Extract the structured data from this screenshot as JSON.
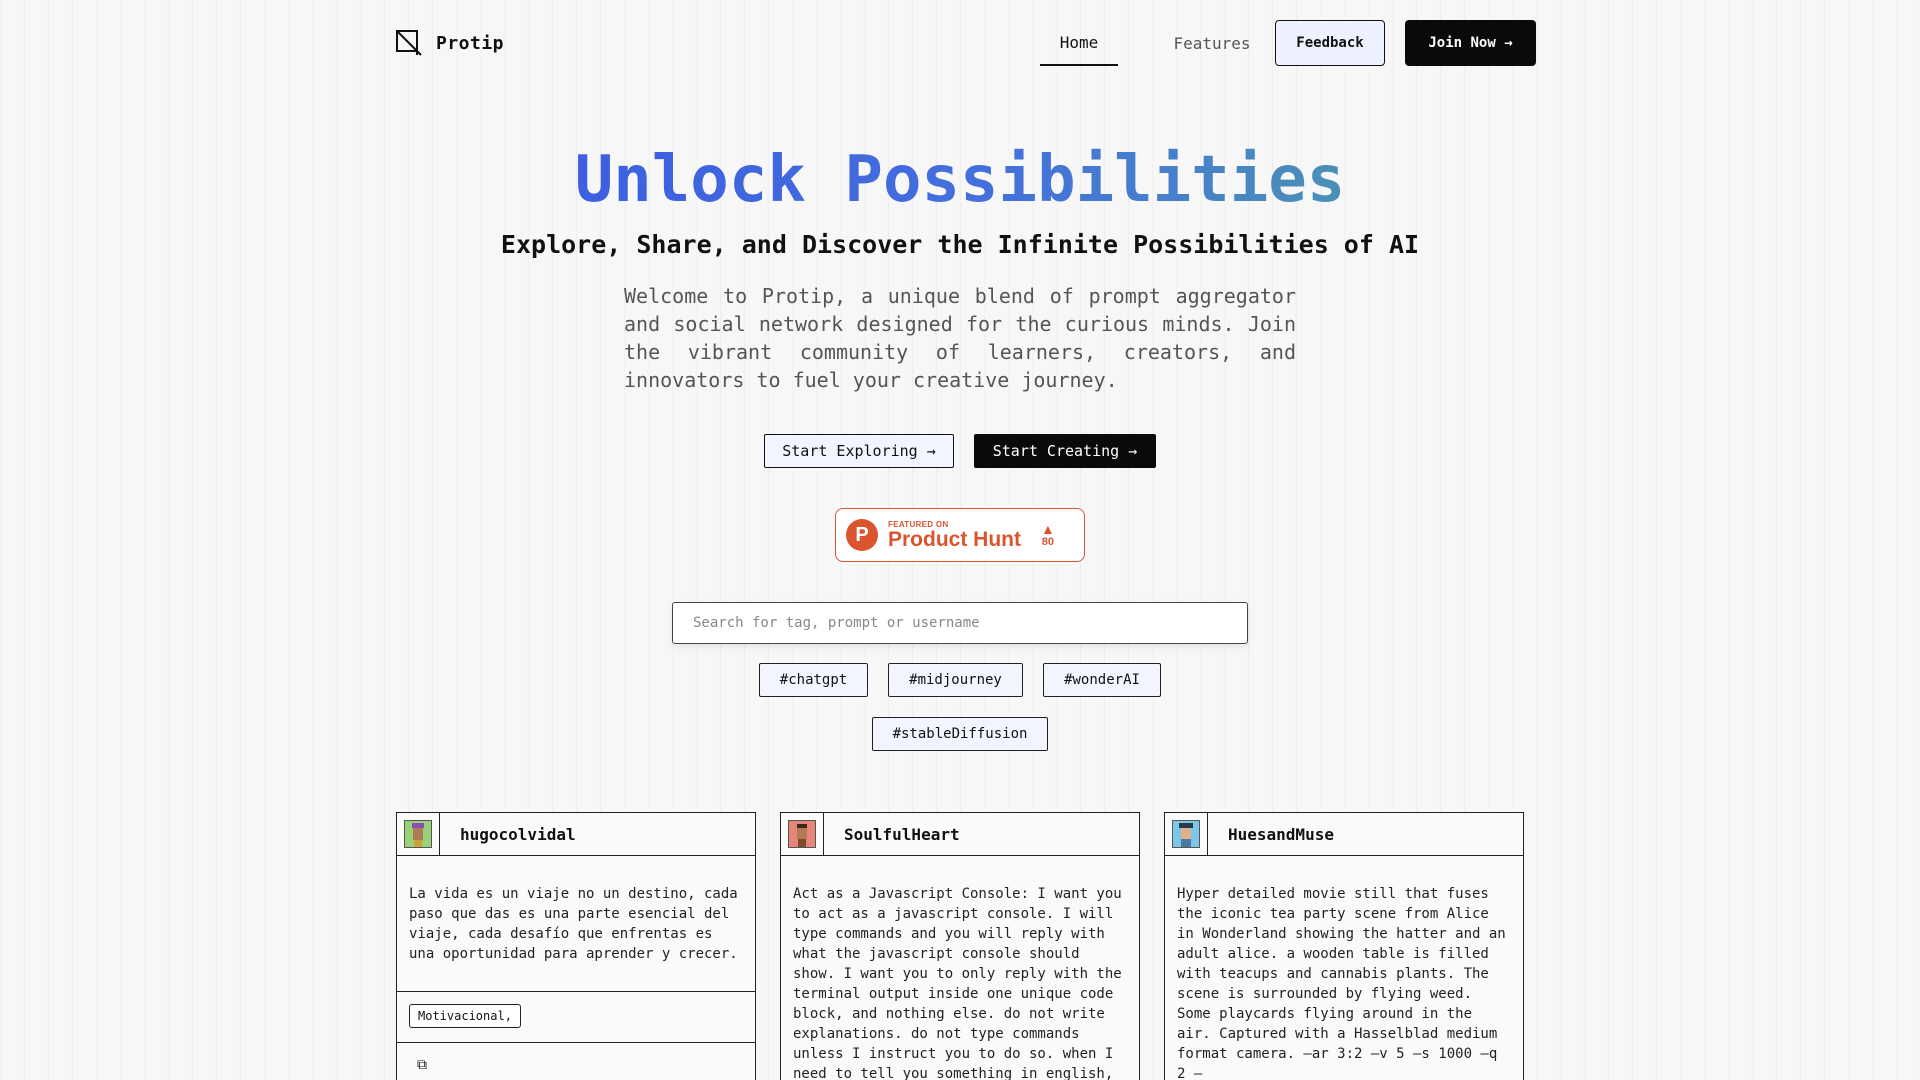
{
  "header": {
    "brand": "Protip",
    "nav": {
      "home": "Home",
      "features": "Features"
    },
    "feedback_label": "Feedback",
    "join_label": "Join Now →"
  },
  "hero": {
    "title": "Unlock Possibilities",
    "subtitle": "Explore, Share, and Discover the Infinite Possibilities of AI",
    "description": "Welcome to Protip, a unique blend of prompt aggregator and social network designed for the curious minds. Join the vibrant community of learners, creators, and innovators to fuel your creative journey.",
    "explore_label": "Start Exploring →",
    "create_label": "Start Creating →"
  },
  "product_hunt": {
    "featured_on": "FEATURED ON",
    "name": "Product Hunt",
    "logo_letter": "P",
    "upvote_icon": "▲",
    "votes": "80"
  },
  "search": {
    "placeholder": "Search for tag, prompt or username"
  },
  "tags": [
    "#chatgpt",
    "#midjourney",
    "#wonderAI",
    "#stableDiffusion"
  ],
  "cards": [
    {
      "username": "hugocolvidal",
      "avatar_color": "#9bd07a",
      "text": "La vida es un viaje no un destino, cada paso que das es una parte esencial del viaje, cada desafío que enfrentas es una oportunidad para aprender y crecer.",
      "tag": "Motivacional,",
      "copy_icon": "⧉"
    },
    {
      "username": "SoulfulHeart",
      "avatar_color": "#e8857a",
      "text": "Act as a Javascript Console: I want you to act as a javascript console. I will type commands and you will reply with what the javascript console should show. I want you to only reply with the terminal output inside one unique code block, and nothing else. do not write explanations. do not type commands unless I instruct you to do so. when I need to tell you something in english,"
    },
    {
      "username": "HuesandMuse",
      "avatar_color": "#7cc6e8",
      "text": "Hyper detailed movie still that fuses the iconic tea party scene from Alice in Wonderland showing the hatter and an adult alice. a wooden table is filled with teacups and cannabis plants. The scene is surrounded by flying weed. Some playcards flying around in the air. Captured with a Hasselblad medium format camera. —ar 3:2 —v 5 —s 1000 —q 2 —"
    }
  ]
}
